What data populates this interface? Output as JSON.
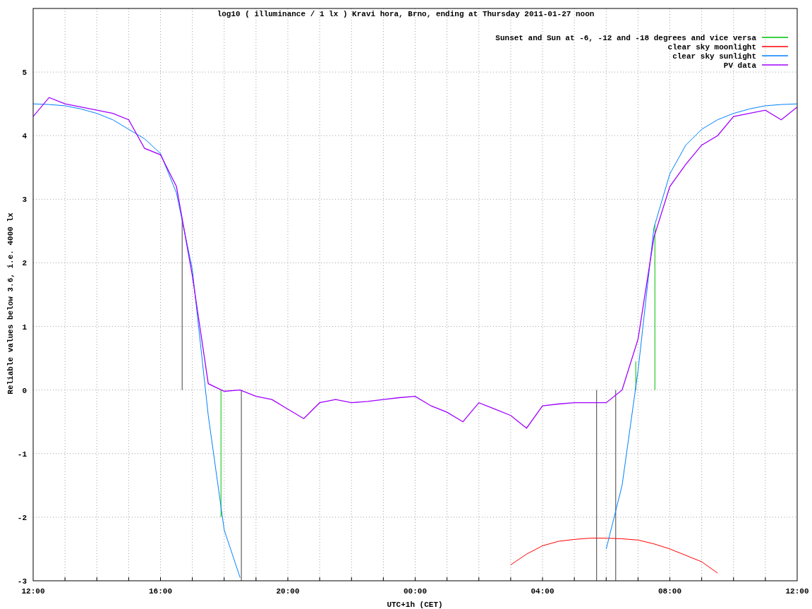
{
  "chart": {
    "chart_data": {
      "type": "line",
      "title": "log10 ( illuminance / 1 lx ) Kravi hora, Brno, ending at Thursday 2011-01-27 noon",
      "xlabel": "UTC+1h (CET)",
      "ylabel": "Reliable values below 3.6, i.e. 4000 lx",
      "ylim": [
        -3,
        6
      ],
      "categories": [
        "12:00",
        null,
        null,
        null,
        null,
        null,
        null,
        null,
        "16:00",
        null,
        null,
        null,
        null,
        null,
        null,
        null,
        "20:00",
        null,
        null,
        null,
        null,
        null,
        null,
        null,
        "00:00",
        null,
        null,
        null,
        null,
        null,
        null,
        null,
        "04:00",
        null,
        null,
        null,
        null,
        null,
        null,
        null,
        "08:00",
        null,
        null,
        null,
        null,
        null,
        null,
        null,
        "12:00"
      ],
      "yticks": [
        -3,
        -2,
        -1,
        0,
        1,
        2,
        3,
        4,
        5
      ],
      "series": [
        {
          "name": "Sunset and Sun at -6, -12 and -18 degrees and vice versa",
          "color": "#00c000",
          "values": [
            null,
            null,
            null,
            null,
            null,
            null,
            null,
            null,
            null,
            null,
            null,
            null,
            null,
            null,
            null,
            null,
            null,
            null,
            null,
            null,
            null,
            null,
            null,
            null,
            null,
            null,
            null,
            null,
            null,
            null,
            null,
            null,
            null,
            null,
            null,
            null,
            null,
            null,
            null,
            null,
            null,
            null,
            null,
            null,
            null,
            null,
            null,
            null,
            null
          ]
        },
        {
          "name": "clear sky moonlight",
          "color": "#ff0000",
          "values": [
            null,
            null,
            null,
            null,
            null,
            null,
            null,
            null,
            null,
            null,
            null,
            null,
            null,
            null,
            null,
            null,
            null,
            null,
            null,
            null,
            null,
            null,
            null,
            null,
            null,
            null,
            null,
            null,
            null,
            null,
            -2.75,
            -2.58,
            -2.45,
            -2.38,
            -2.35,
            -2.33,
            -2.33,
            -2.34,
            -2.36,
            -2.42,
            -2.5,
            -2.6,
            -2.7,
            -2.88,
            null,
            null,
            null,
            null,
            null
          ]
        },
        {
          "name": "clear sky sunlight",
          "color": "#0080ff",
          "values": [
            4.5,
            4.49,
            4.47,
            4.42,
            4.35,
            4.25,
            4.1,
            3.95,
            3.72,
            3.1,
            1.9,
            -0.4,
            -2.2,
            -2.95,
            null,
            null,
            null,
            null,
            null,
            null,
            null,
            null,
            null,
            null,
            null,
            null,
            null,
            null,
            null,
            null,
            null,
            null,
            null,
            null,
            null,
            null,
            -2.5,
            -1.5,
            0.3,
            2.55,
            3.4,
            3.85,
            4.1,
            4.25,
            4.35,
            4.42,
            4.47,
            4.49,
            4.5
          ]
        },
        {
          "name": "PV data",
          "color": "#a000ff",
          "values": [
            4.3,
            4.6,
            4.5,
            4.45,
            4.4,
            4.35,
            4.25,
            3.8,
            3.7,
            3.2,
            1.8,
            0.1,
            -0.02,
            0,
            -0.1,
            -0.15,
            -0.3,
            -0.45,
            -0.2,
            -0.15,
            -0.2,
            -0.18,
            -0.15,
            -0.12,
            -0.1,
            -0.25,
            -0.35,
            -0.5,
            -0.2,
            -0.3,
            -0.4,
            -0.6,
            -0.25,
            -0.22,
            -0.2,
            -0.2,
            -0.2,
            0,
            0.8,
            2.4,
            3.2,
            3.55,
            3.85,
            4,
            4.3,
            4.35,
            4.4,
            4.25,
            4.45
          ]
        }
      ],
      "grid": true,
      "legend": "upper right"
    }
  }
}
